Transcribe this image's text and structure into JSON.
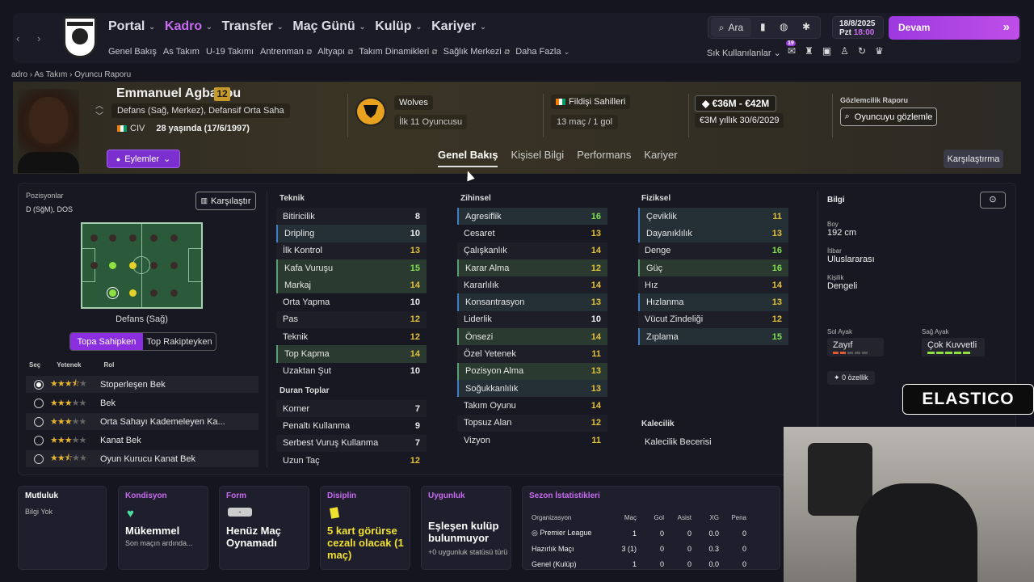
{
  "nav": {
    "menu": [
      {
        "label": "Portal",
        "active": false
      },
      {
        "label": "Kadro",
        "active": true
      },
      {
        "label": "Transfer",
        "active": false
      },
      {
        "label": "Maç Günü",
        "active": false
      },
      {
        "label": "Kulüp",
        "active": false
      },
      {
        "label": "Kariyer",
        "active": false
      }
    ],
    "submenu": [
      "Genel Bakış",
      "As Takım",
      "U-19 Takımı",
      "Antrenman",
      "Altyapı",
      "Takım Dinamikleri",
      "Sağlık Merkezi",
      "Daha Fazla"
    ],
    "search": "Ara",
    "date": "18/8/2025",
    "day": "Pzt",
    "time": "18:00",
    "continue": "Devam",
    "favorites": "Sık Kullanılanlar",
    "badge": "19"
  },
  "breadcrumb": {
    "a": "adro",
    "b": "As Takım",
    "c": "Oyuncu Raporu"
  },
  "player": {
    "name": "Emmanuel Agbadou",
    "number": "12",
    "position": "Defans (Sağ, Merkez), Defansif Orta Saha",
    "nation": "CIV",
    "age": "28 yaşında (17/6/1997)",
    "club": "Wolves",
    "squad": "İlk 11 Oyuncusu",
    "national_team": "Fildişi Sahilleri",
    "caps": "13 maç / 1 gol",
    "value": "€36M - €42M",
    "wage": "€3M yıllık",
    "contract": "30/6/2029",
    "scout_label": "Gözlemcilik Raporu",
    "scout_btn": "Oyuncuyu gözlemle",
    "actions": "Eylemler"
  },
  "tabs": [
    "Genel Bakış",
    "Kişisel Bilgi",
    "Performans",
    "Kariyer"
  ],
  "compare": "Karşılaştırma",
  "positions": {
    "label": "Pozisyonlar",
    "value": "D (SğM), DOS",
    "compare": "Karşılaştır",
    "pitch_label": "Defans (Sağ)",
    "toggle_on": "Topa Sahipken",
    "toggle_off": "Top Rakipteyken",
    "head_sec": "Seç",
    "head_yetenek": "Yetenek",
    "head_rol": "Rol"
  },
  "roles": [
    {
      "name": "Stoperleşen Bek",
      "stars": 3.5,
      "sel": true
    },
    {
      "name": "Bek",
      "stars": 3,
      "sel": false
    },
    {
      "name": "Orta Sahayı Kademeleyen Ka...",
      "stars": 3,
      "sel": false
    },
    {
      "name": "Kanat Bek",
      "stars": 3,
      "sel": false
    },
    {
      "name": "Oyun Kurucu Kanat Bek",
      "stars": 2.5,
      "sel": false
    }
  ],
  "teknik": {
    "title": "Teknik",
    "items": [
      [
        "Bitiricilik",
        "8"
      ],
      [
        "Dripling",
        "10"
      ],
      [
        "İlk Kontrol",
        "13"
      ],
      [
        "Kafa Vuruşu",
        "15"
      ],
      [
        "Markaj",
        "14"
      ],
      [
        "Orta Yapma",
        "10"
      ],
      [
        "Pas",
        "12"
      ],
      [
        "Teknik",
        "12"
      ],
      [
        "Top Kapma",
        "14"
      ],
      [
        "Uzaktan Şut",
        "10"
      ]
    ]
  },
  "duran": {
    "title": "Duran Toplar",
    "items": [
      [
        "Korner",
        "7"
      ],
      [
        "Penaltı Kullanma",
        "9"
      ],
      [
        "Serbest Vuruş Kullanma",
        "7"
      ],
      [
        "Uzun Taç",
        "12"
      ]
    ]
  },
  "zihinsel": {
    "title": "Zihinsel",
    "items": [
      [
        "Agresiflik",
        "16"
      ],
      [
        "Cesaret",
        "13"
      ],
      [
        "Çalışkanlık",
        "14"
      ],
      [
        "Karar Alma",
        "12"
      ],
      [
        "Kararlılık",
        "14"
      ],
      [
        "Konsantrasyon",
        "13"
      ],
      [
        "Liderlik",
        "10"
      ],
      [
        "Önsezi",
        "14"
      ],
      [
        "Özel Yetenek",
        "11"
      ],
      [
        "Pozisyon Alma",
        "13"
      ],
      [
        "Soğukkanlılık",
        "13"
      ],
      [
        "Takım Oyunu",
        "14"
      ],
      [
        "Topsuz Alan",
        "12"
      ],
      [
        "Vizyon",
        "11"
      ]
    ]
  },
  "fiziksel": {
    "title": "Fiziksel",
    "items": [
      [
        "Çeviklik",
        "11"
      ],
      [
        "Dayanıklılık",
        "13"
      ],
      [
        "Denge",
        "16"
      ],
      [
        "Güç",
        "16"
      ],
      [
        "Hız",
        "14"
      ],
      [
        "Hızlanma",
        "13"
      ],
      [
        "Vücut Zindeliği",
        "12"
      ],
      [
        "Zıplama",
        "15"
      ]
    ]
  },
  "kalecilik": {
    "title": "Kalecilik",
    "item": "Kalecilik Becerisi"
  },
  "bilgi": {
    "title": "Bilgi",
    "boy_l": "Boy",
    "boy": "192 cm",
    "itibar_l": "İtibar",
    "itibar": "Uluslararası",
    "kisilik_l": "Kişilik",
    "kisilik": "Dengeli",
    "sol_l": "Sol Ayak",
    "sol": "Zayıf",
    "sag_l": "Sağ Ayak",
    "sag": "Çok Kuvvetli",
    "ozellik": "0 özellik"
  },
  "footer": {
    "mutluluk": "Mutluluk",
    "mutluluk_v": "Bilgi Yok",
    "kondisyon": "Kondisyon",
    "kondisyon_v": "Mükemmel",
    "kondisyon_s": "Son maçın ardında...",
    "form": "Form",
    "form_badge": "-",
    "form_v": "Henüz Maç Oynamadı",
    "disiplin": "Disiplin",
    "disiplin_v": "5 kart görürse cezalı olacak (1 maç)",
    "uygunluk": "Uygunluk",
    "uygunluk_v": "Eşleşen kulüp bulunmuyor",
    "uygunluk_s": "+0 uygunluk statüsü türü",
    "sezon": "Sezon İstatistikleri"
  },
  "season": {
    "headers": [
      "Organizasyon",
      "Maç",
      "Gol",
      "Asist",
      "XG",
      "Pena"
    ],
    "rows": [
      [
        "Premier League",
        "1",
        "0",
        "0",
        "0.0",
        "0"
      ],
      [
        "Hazırlık Maçı",
        "3 (1)",
        "0",
        "0",
        "0.3",
        "0"
      ],
      [
        "Genel (Kulüp)",
        "1",
        "0",
        "0",
        "0.0",
        "0"
      ]
    ]
  },
  "overlay": "ELASTICO"
}
